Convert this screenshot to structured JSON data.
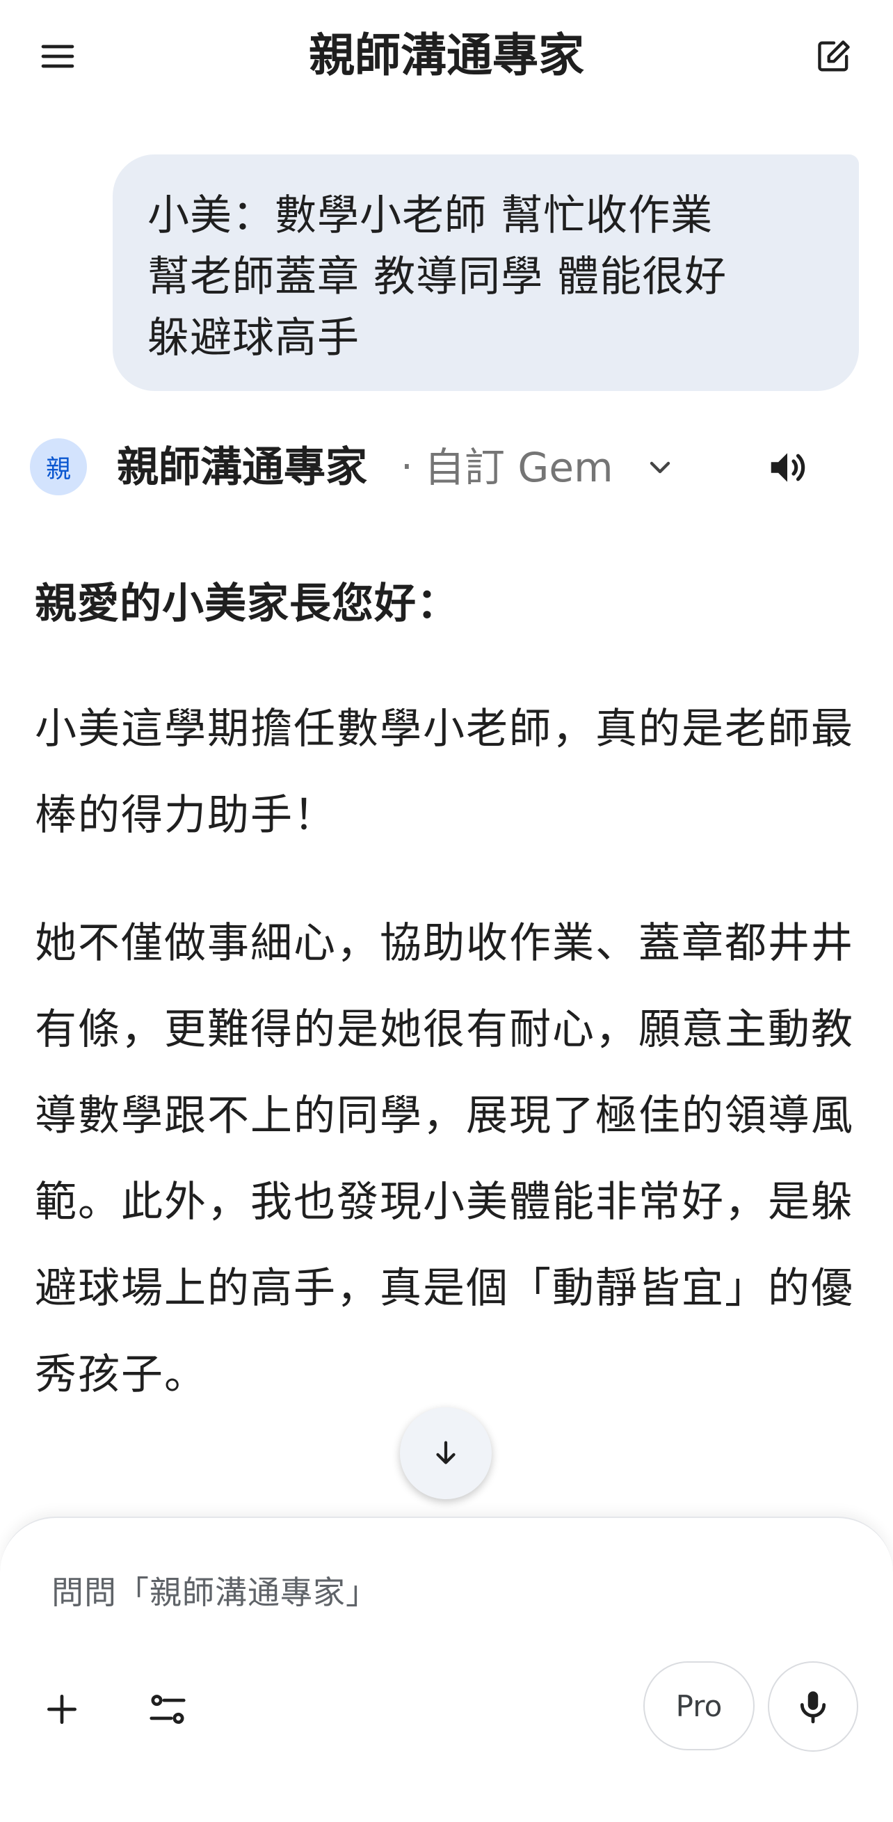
{
  "header": {
    "title": "親師溝通專家",
    "menu_icon": "menu-icon",
    "new_chat_icon": "edit-icon"
  },
  "user_message": {
    "lines": [
      "小美：數學小老師 幫忙收作業",
      "幫老師蓋章 教導同學 體能很好",
      "躲避球高手"
    ]
  },
  "gem": {
    "avatar_text": "親",
    "name": "親師溝通專家",
    "separator": "·",
    "type": "自訂 Gem",
    "dropdown_icon": "chevron-down-icon",
    "speaker_icon": "speaker-icon"
  },
  "response": {
    "greeting": "親愛的小美家長您好：",
    "paragraph_1": "小美這學期擔任數學小老師，真的是老師最棒的得力助手！",
    "paragraph_2": "她不僅做事細心，協助收作業、蓋章都井井有條，更難得的是她很有耐心，願意主動教導數學跟不上的同學，展現了極佳的領導風範。此外，我也發現小美體能非常好，是躲避球場上的高手，真是個「動靜皆宜」的優秀孩子。"
  },
  "input": {
    "placeholder": "問問「親師溝通專家」",
    "pro_label": "Pro",
    "plus_icon": "plus-icon",
    "tools_icon": "tools-icon",
    "mic_icon": "mic-icon"
  },
  "colors": {
    "bubble_bg": "#e8edf5",
    "avatar_bg": "#d3e3fd",
    "avatar_fg": "#0b57d0",
    "muted_text": "#757575"
  }
}
